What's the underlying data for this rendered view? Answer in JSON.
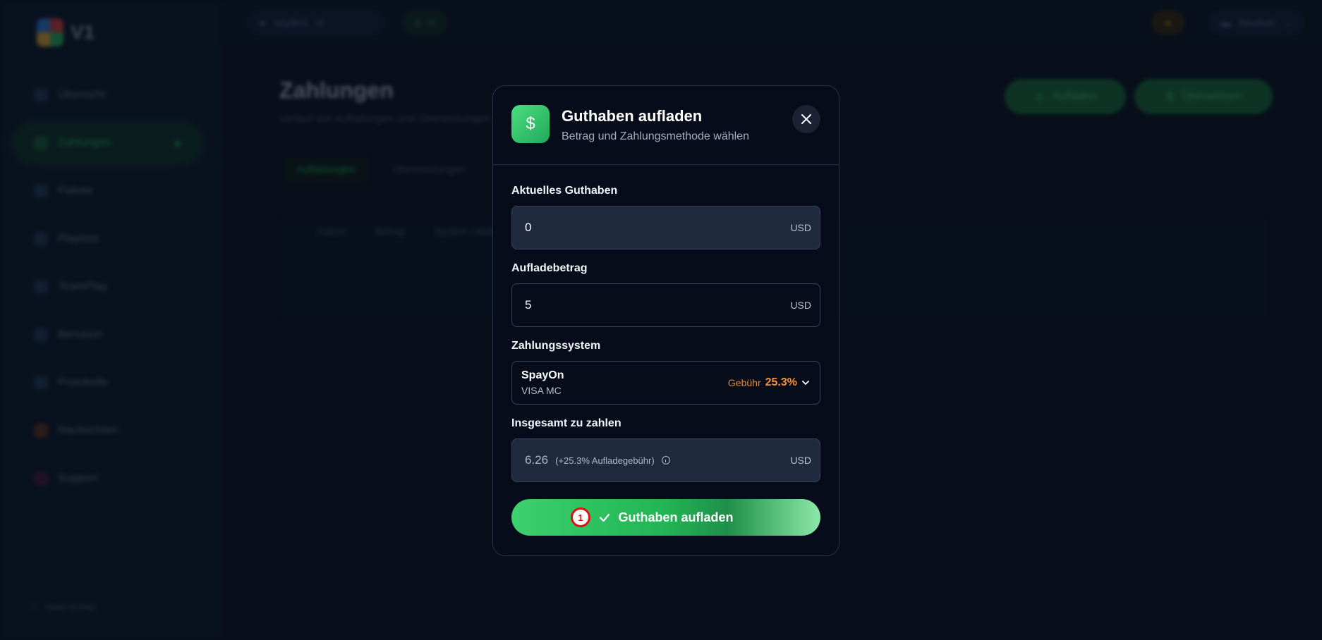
{
  "sidebar": {
    "logo_text": "V1",
    "items": [
      {
        "label": "Übersicht"
      },
      {
        "label": "Zahlungen"
      },
      {
        "label": "Pakete"
      },
      {
        "label": "Playlists"
      },
      {
        "label": "TeamPlay"
      },
      {
        "label": "Benutzer"
      },
      {
        "label": "Protokolle"
      },
      {
        "label": "Nachrichten"
      },
      {
        "label": "Support"
      }
    ],
    "logout_label": "Mein Konto"
  },
  "topbar": {
    "user_label": "zeydin1",
    "balance_label": "0",
    "language": "Deutsch"
  },
  "main": {
    "title": "Zahlungen",
    "subtitle": "Verlauf von Aufladungen und Überweisungen",
    "topup_button": "Aufladen",
    "transfer_button": "Überweisen",
    "tabs": [
      "Aufladungen",
      "Überweisungen"
    ],
    "columns": [
      "Datum",
      "Betrag",
      "System / Methode"
    ]
  },
  "modal": {
    "title": "Guthaben aufladen",
    "subtitle": "Betrag und Zahlungsmethode wählen",
    "current_balance": {
      "label": "Aktuelles Guthaben",
      "value": "0",
      "unit": "USD"
    },
    "amount": {
      "label": "Aufladebetrag",
      "value": "5",
      "unit": "USD"
    },
    "payment_system": {
      "label": "Zahlungssystem",
      "name": "SpayOn",
      "methods": "VISA MC",
      "fee_label": "Gebühr",
      "fee_value": "25.3%"
    },
    "total": {
      "label": "Insgesamt zu zahlen",
      "value": "6.26",
      "note": "(+25.3% Aufladegebühr)",
      "unit": "USD"
    },
    "submit_label": "Guthaben aufladen",
    "step_badge": "1"
  },
  "colors": {
    "accent": "#22c55e",
    "fee": "#f6923a",
    "modal_bg": "#070c1a"
  }
}
